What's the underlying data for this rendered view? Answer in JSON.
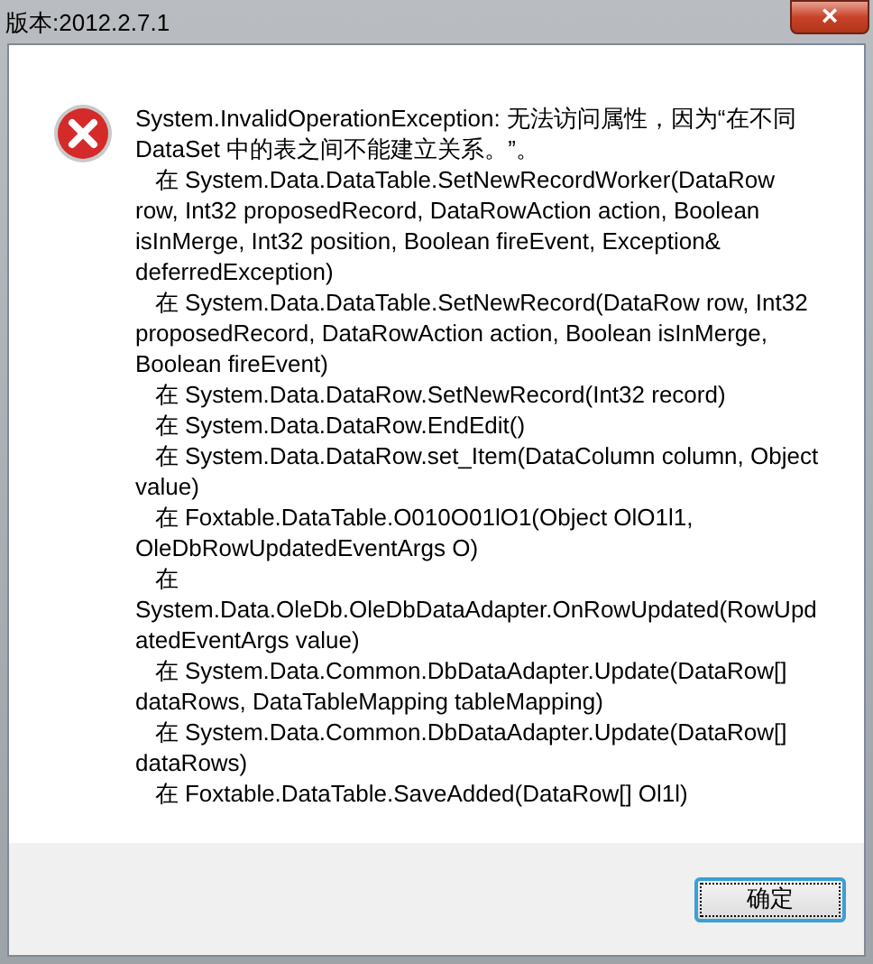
{
  "window": {
    "title": "版本:2012.2.7.1",
    "close": "×"
  },
  "message": {
    "lines": [
      "System.InvalidOperationException: 无法访问属性，因为“在不同",
      "DataSet 中的表之间不能建立关系。”。",
      "   在 System.Data.DataTable.SetNewRecordWorker(DataRow",
      "row, Int32 proposedRecord, DataRowAction action, Boolean",
      "isInMerge, Int32 position, Boolean fireEvent, Exception&",
      "deferredException)",
      "   在 System.Data.DataTable.SetNewRecord(DataRow row, Int32",
      "proposedRecord, DataRowAction action, Boolean isInMerge,",
      "Boolean fireEvent)",
      "   在 System.Data.DataRow.SetNewRecord(Int32 record)",
      "   在 System.Data.DataRow.EndEdit()",
      "   在 System.Data.DataRow.set_Item(DataColumn column, Object",
      "value)",
      "   在 Foxtable.DataTable.O010O01lO1(Object OlO1l1,",
      "OleDbRowUpdatedEventArgs O)",
      "   在",
      "System.Data.OleDb.OleDbDataAdapter.OnRowUpdated(RowUpd",
      "atedEventArgs value)",
      "   在 System.Data.Common.DbDataAdapter.Update(DataRow[]",
      "dataRows, DataTableMapping tableMapping)",
      "   在 System.Data.Common.DbDataAdapter.Update(DataRow[]",
      "dataRows)",
      "   在 Foxtable.DataTable.SaveAdded(DataRow[] Ol1l)"
    ]
  },
  "buttons": [
    {
      "label": "确定",
      "selected": true
    }
  ]
}
